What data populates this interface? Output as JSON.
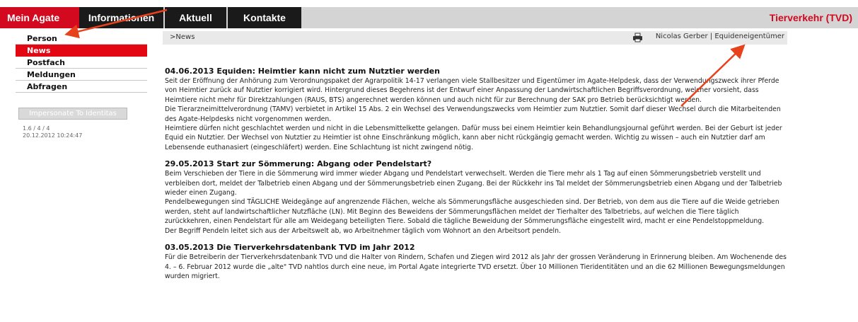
{
  "topnav": {
    "tabs": [
      {
        "label": "Mein Agate"
      },
      {
        "label": "Informationen"
      },
      {
        "label": "Aktuell"
      },
      {
        "label": "Kontakte"
      }
    ],
    "brand": "Tierverkehr (TVD)"
  },
  "sidebar": {
    "items": [
      {
        "label": "Person"
      },
      {
        "label": "News"
      },
      {
        "label": "Postfach"
      },
      {
        "label": "Meldungen"
      },
      {
        "label": "Abfragen"
      }
    ],
    "impersonate_label": "Impersonate To Identitas",
    "version": "1.6 / 4 / 4",
    "timestamp": "20.12.2012 10:24:47"
  },
  "breadcrumb": ">News",
  "user": "Nicolas Gerber | Equideneigentümer",
  "colors": {
    "accent": "#d2091f",
    "nav_dark": "#1a1a1a",
    "annotation_arrow": "#e8421c"
  },
  "articles": [
    {
      "title": "04.06.2013  Equiden: Heimtier kann nicht zum Nutztier werden",
      "paragraphs": [
        "Seit der Eröffnung der Anhörung zum Verordnungspaket der Agrarpolitik 14-17 verlangen viele Stallbesitzer und Eigentümer im Agate-Helpdesk, dass der Verwendungszweck ihrer Pferde von Heimtier zurück auf Nutztier korrigiert wird. Hintergrund dieses Begehrens ist der Entwurf einer Anpassung der Landwirtschaftlichen Begriffsverordnung, welcher vorsieht, dass Heimtiere nicht mehr für Direktzahlungen (RAUS, BTS) angerechnet werden können und auch nicht für zur Berechnung der SAK pro Betrieb berücksichtigt werden.",
        "Die Tierarzneimittelverordnung (TAMV) verbietet in Artikel 15 Abs. 2 ein Wechsel des Verwendungszwecks vom Heimtier zum Nutztier. Somit darf dieser Wechsel durch die Mitarbeitenden des Agate-Helpdesks nicht vorgenommen werden.",
        "Heimtiere dürfen nicht geschlachtet werden und nicht in die Lebensmittelkette gelangen. Dafür muss bei einem Heimtier kein Behandlungsjournal geführt werden. Bei der Geburt ist jeder Equid ein Nutztier. Der Wechsel von Nutztier zu Heimtier ist ohne Einschränkung möglich, kann aber nicht rückgängig gemacht werden. Wichtig zu wissen – auch ein Nutztier darf am Lebensende euthanasiert (eingeschläfert) werden. Eine Schlachtung ist nicht zwingend nötig."
      ]
    },
    {
      "title": "29.05.2013  Start zur Sömmerung: Abgang oder Pendelstart?",
      "paragraphs": [
        "Beim Verschieben der Tiere in die Sömmerung wird immer wieder Abgang und Pendelstart verwechselt. Werden die Tiere mehr als 1 Tag auf einen Sömmerungsbetrieb verstellt und verbleiben dort, meldet der Talbetrieb einen Abgang und der Sömmerungsbetrieb einen Zugang. Bei der Rückkehr ins Tal meldet der Sömmerungsbetrieb einen Abgang und der Talbetrieb wieder einen Zugang.",
        "Pendelbewegungen sind TÄGLICHE Weidegänge auf angrenzende Flächen, welche als Sömmerungsfläche ausgeschieden sind. Der Betrieb, von dem aus die Tiere auf die Weide getrieben werden, steht auf landwirtschaftlicher Nutzfläche (LN). Mit Beginn des Beweidens der Sömmerungsflächen meldet der Tierhalter des Talbetriebs, auf welchen die Tiere täglich zurückkehren, einen Pendelstart für alle am Weidegang beteiligten Tiere. Sobald die tägliche Beweidung der Sömmerungsfläche eingestellt wird, macht er eine Pendelstoppmeldung.",
        "Der Begriff Pendeln leitet sich aus der Arbeitswelt ab, wo Arbeitnehmer täglich vom Wohnort an den Arbeitsort pendeln."
      ]
    },
    {
      "title": "03.05.2013  Die Tierverkehrsdatenbank TVD im Jahr 2012",
      "paragraphs": [
        "Für die Betreiberin der Tierverkehrsdatenbank TVD und die Halter von Rindern, Schafen und Ziegen wird 2012 als Jahr der grossen Veränderung in Erinnerung bleiben. Am Wochenende des 4. – 6. Februar 2012 wurde die „alte\" TVD nahtlos durch eine neue, im Portal Agate integrierte TVD ersetzt. Über 10 Millionen Tieridentitäten und an die 62 Millionen Bewegungsmeldungen wurden migriert."
      ]
    }
  ]
}
